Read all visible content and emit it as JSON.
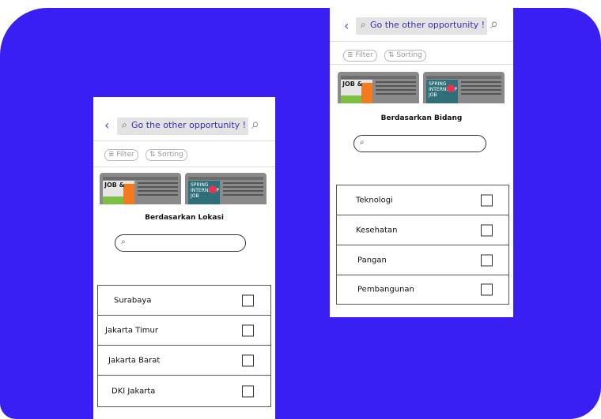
{
  "left_screen": {
    "search_placeholder": "Go the other opportunity !",
    "filter_label": "Filter",
    "sorting_label": "Sorting",
    "sheet_title": "Berdasarkan Lokasi",
    "options": [
      "Surabaya",
      "Jakarta Timur",
      "Jakarta Barat",
      "DKI Jakarta"
    ]
  },
  "right_screen": {
    "search_placeholder": "Go the other opportunity !",
    "filter_label": "Filter",
    "sorting_label": "Sorting",
    "sheet_title": "Berdasarkan Bidang",
    "options": [
      "Teknologi",
      "Kesehatan",
      "Pangan",
      "Pembangunan"
    ]
  },
  "posters": {
    "card1_text": "JOB & INTERNSHIP FAIR",
    "card2_text": "SPRING INTERNSHIP JOB FAIR"
  },
  "colors": {
    "background_blob": "#3a1ff5",
    "accent": "#5046e5"
  }
}
